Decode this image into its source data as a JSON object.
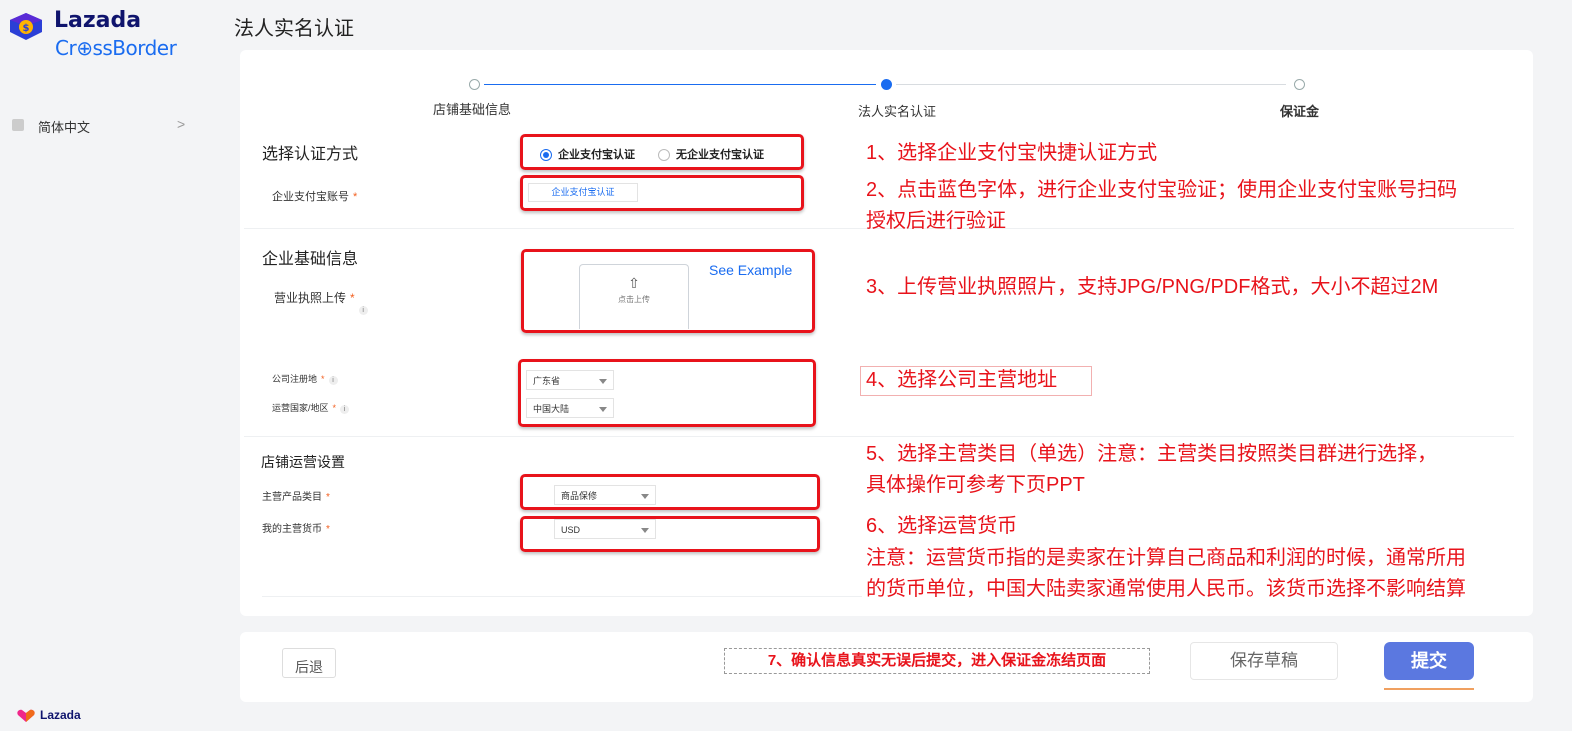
{
  "sidebar": {
    "brand_line1": "Lazada",
    "brand_line2": "Cr⊕ssBorder",
    "language_label": "简体中文",
    "language_chevron": ">",
    "bottom_brand": "Lazada"
  },
  "page_title": "法人实名认证",
  "steps": [
    {
      "label": "店铺基础信息",
      "state": "done"
    },
    {
      "label": "法人实名认证",
      "state": "active"
    },
    {
      "label": "保证金",
      "state": "pending"
    }
  ],
  "verify": {
    "section_title": "选择认证方式",
    "option_company": "企业支付宝认证",
    "option_none": "无企业支付宝认证",
    "account_label": "企业支付宝账号",
    "account_button": "企业支付宝认证"
  },
  "company": {
    "section_title": "企业基础信息",
    "license_label": "营业执照上传",
    "upload_icon": "upload-icon",
    "upload_text": "点击上传",
    "see_example": "See Example",
    "reg_place_label": "公司注册地",
    "reg_place_value": "广东省",
    "country_label": "运营国家/地区",
    "country_value": "中国大陆"
  },
  "operation": {
    "section_title": "店铺运营设置",
    "category_label": "主营产品类目",
    "category_value": "商品保修",
    "currency_label": "我的主营货币",
    "currency_value": "USD"
  },
  "annotations": {
    "a1": "1、选择企业支付宝快捷认证方式",
    "a2_line1": "2、点击蓝色字体，进行企业支付宝验证；使用企业支付宝账号扫码",
    "a2_line2": "授权后进行验证",
    "a3": "3、上传营业执照照片，支持JPG/PNG/PDF格式，大小不超过2M",
    "a4": "4、选择公司主营地址",
    "a5_line1": "5、选择主营类目（单选）注意：主营类目按照类目群进行选择，",
    "a5_line2": "具体操作可参考下页PPT",
    "a6_line1": "6、选择运营货币",
    "a6_line2": "注意：运营货币指的是卖家在计算自己商品和利润的时候，通常所用",
    "a6_line3": "的货币单位，中国大陆卖家通常使用人民币。该货币选择不影响结算",
    "a7": "7、确认信息真实无误后提交，进入保证金冻结页面"
  },
  "footer": {
    "back_label": "后退",
    "draft_label": "保存草稿",
    "submit_label": "提交"
  },
  "colors": {
    "accent": "#1a6cf0",
    "annotation_red": "#e8131b",
    "submit_bg": "#5b78e0",
    "brand_navy": "#0f146d"
  }
}
